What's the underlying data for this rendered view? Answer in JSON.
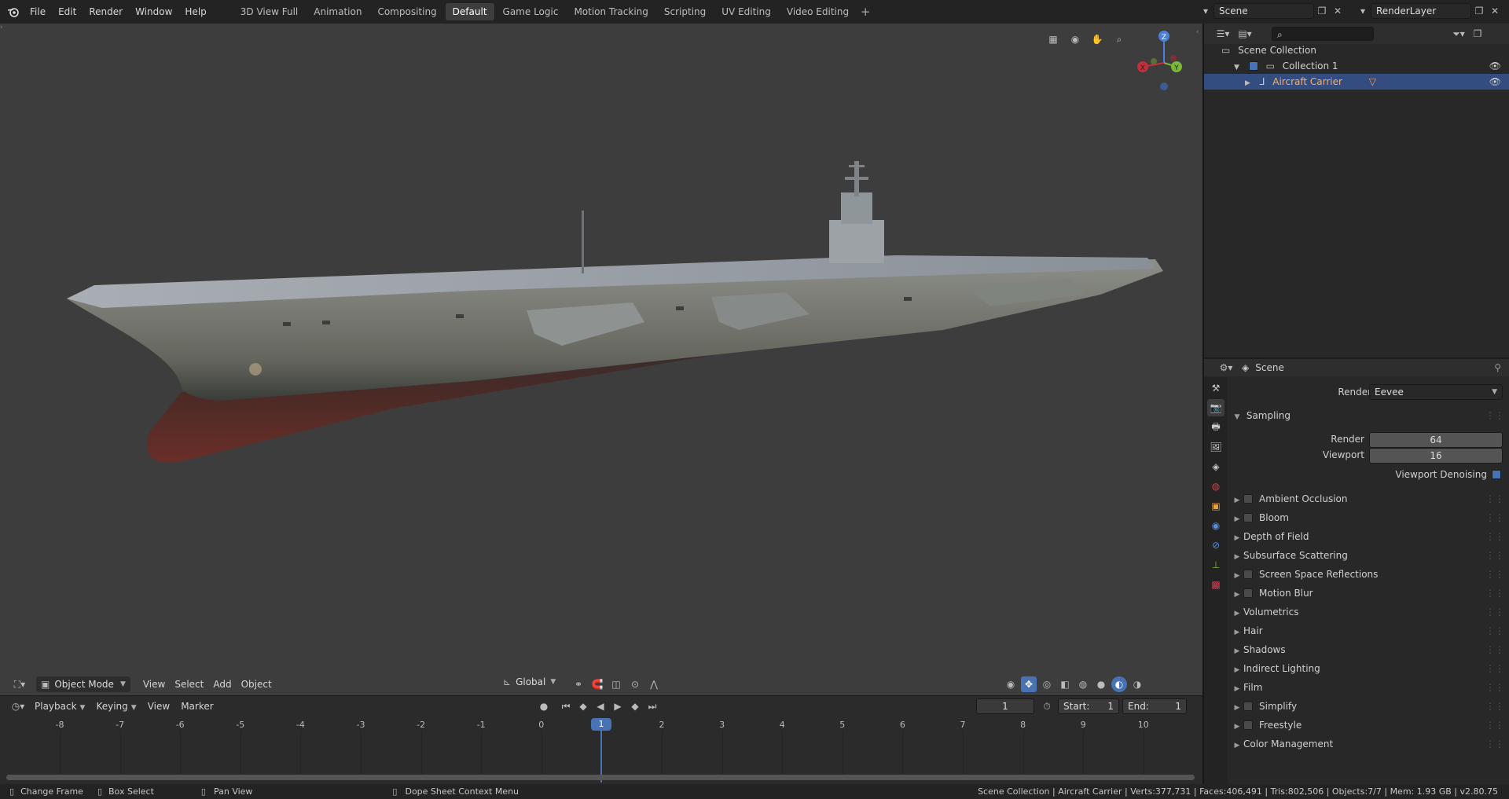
{
  "menu": [
    "File",
    "Edit",
    "Render",
    "Window",
    "Help"
  ],
  "workspaces": [
    {
      "label": "3D View Full",
      "active": false
    },
    {
      "label": "Animation",
      "active": false
    },
    {
      "label": "Compositing",
      "active": false
    },
    {
      "label": "Default",
      "active": true
    },
    {
      "label": "Game Logic",
      "active": false
    },
    {
      "label": "Motion Tracking",
      "active": false
    },
    {
      "label": "Scripting",
      "active": false
    },
    {
      "label": "UV Editing",
      "active": false
    },
    {
      "label": "Video Editing",
      "active": false
    }
  ],
  "top_right": {
    "scene": "Scene",
    "render_layer": "RenderLayer"
  },
  "gizmo": {
    "z": "Z",
    "y": "Y",
    "x": "X"
  },
  "vp_header": {
    "mode": "Object Mode",
    "menus": [
      "View",
      "Select",
      "Add",
      "Object"
    ],
    "orientation": "Global"
  },
  "outliner": {
    "root": "Scene Collection",
    "collection": "Collection 1",
    "object": "Aircraft Carrier"
  },
  "properties": {
    "header": "Scene",
    "render_engine_label": "Render Engine",
    "render_engine": "Eevee",
    "sampling": "Sampling",
    "render_label": "Render",
    "render_value": "64",
    "viewport_label": "Viewport",
    "viewport_value": "16",
    "denoise_label": "Viewport Denoising",
    "panels": [
      {
        "label": "Ambient Occlusion",
        "checkbox": true
      },
      {
        "label": "Bloom",
        "checkbox": true
      },
      {
        "label": "Depth of Field",
        "checkbox": false
      },
      {
        "label": "Subsurface Scattering",
        "checkbox": false
      },
      {
        "label": "Screen Space Reflections",
        "checkbox": true
      },
      {
        "label": "Motion Blur",
        "checkbox": true
      },
      {
        "label": "Volumetrics",
        "checkbox": false
      },
      {
        "label": "Hair",
        "checkbox": false
      },
      {
        "label": "Shadows",
        "checkbox": false
      },
      {
        "label": "Indirect Lighting",
        "checkbox": false
      },
      {
        "label": "Film",
        "checkbox": false
      },
      {
        "label": "Simplify",
        "checkbox": true
      },
      {
        "label": "Freestyle",
        "checkbox": true
      },
      {
        "label": "Color Management",
        "checkbox": false
      }
    ]
  },
  "timeline": {
    "menus": [
      "Playback",
      "Keying",
      "View",
      "Marker"
    ],
    "current_frame": "1",
    "start_label": "Start:",
    "start": "1",
    "end_label": "End:",
    "end": "1",
    "ticks": [
      "-8",
      "-7",
      "-6",
      "-5",
      "-4",
      "-3",
      "-2",
      "-1",
      "0",
      "1",
      "2",
      "3",
      "4",
      "5",
      "6",
      "7",
      "8",
      "9",
      "10"
    ],
    "playhead": "1"
  },
  "status": {
    "change_frame": "Change Frame",
    "box_select": "Box Select",
    "pan_view": "Pan View",
    "context_menu": "Dope Sheet Context Menu",
    "stats": "Scene Collection | Aircraft Carrier | Verts:377,731 | Faces:406,491 | Tris:802,506 | Objects:7/7 | Mem: 1.93 GB | v2.80.75"
  }
}
